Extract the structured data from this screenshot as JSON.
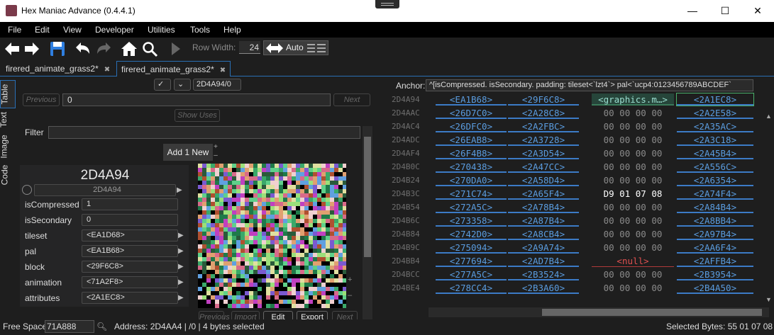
{
  "window": {
    "title": "Hex Maniac Advance (0.4.4.1)",
    "minimize": "—",
    "maximize": "☐",
    "close": "✕"
  },
  "menu": [
    "File",
    "Edit",
    "View",
    "Developer",
    "Utilities",
    "Tools",
    "Help"
  ],
  "toolbar": {
    "row_width_label": "Row Width:",
    "row_width_value": "24",
    "auto_label": "Auto",
    "icons": [
      "back-icon",
      "forward-icon",
      "save-icon",
      "undo-icon",
      "redo-icon",
      "home-icon",
      "search-icon",
      "run-icon"
    ]
  },
  "tabs": [
    {
      "label": "firered_animate_grass2*",
      "close": "✖"
    },
    {
      "label": "firered_animate_grass2*",
      "close": "✖"
    }
  ],
  "left": {
    "side_tabs": [
      "Table",
      "Text",
      "Image",
      "Code"
    ],
    "address_chip": "2D4A94/0",
    "previous": "Previous",
    "next": "Next",
    "index_value": "0",
    "show_uses": "Show Uses",
    "filter_label": "Filter",
    "add_new": "Add 1 New",
    "big_address": "2D4A94",
    "sub_address": "2D4A94",
    "fields": [
      {
        "label": "isCompressed",
        "value": "1"
      },
      {
        "label": "isSecondary",
        "value": "0"
      },
      {
        "label": "tileset",
        "value": "<EA1D68>"
      },
      {
        "label": "pal",
        "value": "<EA1B68>"
      },
      {
        "label": "block",
        "value": "<29F6C8>"
      },
      {
        "label": "animation",
        "value": "<71A2F8>"
      },
      {
        "label": "attributes",
        "value": "<2A1EC8>"
      }
    ],
    "image_buttons": [
      "Previous",
      "Import",
      "Edit",
      "Export",
      "Next"
    ]
  },
  "right": {
    "anchor_label": "Anchor:",
    "anchor_value": "^[isCompressed. isSecondary. padding: tileset<`lzt4`> pal<`ucp4:0123456789ABCDEF`",
    "rows": [
      {
        "addr": "2D4A94",
        "c0": "<EA1B68>",
        "c1": "<29F6C8>",
        "c2": "<graphics.m…>",
        "c3": "<2A1EC8>"
      },
      {
        "addr": "2D4AAC",
        "c0": "<26D7C0>",
        "c1": "<2A28C8>",
        "c2": "00 00 00 00",
        "c3": "<2A2E58>"
      },
      {
        "addr": "2D4AC4",
        "c0": "<26DFC0>",
        "c1": "<2A2FBC>",
        "c2": "00 00 00 00",
        "c3": "<2A35AC>"
      },
      {
        "addr": "2D4ADC",
        "c0": "<26EAB8>",
        "c1": "<2A3728>",
        "c2": "00 00 00 00",
        "c3": "<2A3C18>"
      },
      {
        "addr": "2D4AF4",
        "c0": "<26F4B8>",
        "c1": "<2A3D54>",
        "c2": "00 00 00 00",
        "c3": "<2A45B4>"
      },
      {
        "addr": "2D4B0C",
        "c0": "<270438>",
        "c1": "<2A47CC>",
        "c2": "00 00 00 00",
        "c3": "<2A556C>"
      },
      {
        "addr": "2D4B24",
        "c0": "<270DA0>",
        "c1": "<2A58D4>",
        "c2": "00 00 00 00",
        "c3": "<2A6354>"
      },
      {
        "addr": "2D4B3C",
        "c0": "<271C74>",
        "c1": "<2A65F4>",
        "c2": "D9 01 07 08",
        "c3": "<2A74F4>"
      },
      {
        "addr": "2D4B54",
        "c0": "<272A5C>",
        "c1": "<2A78B4>",
        "c2": "00 00 00 00",
        "c3": "<2A84B4>"
      },
      {
        "addr": "2D4B6C",
        "c0": "<273358>",
        "c1": "<2A87B4>",
        "c2": "00 00 00 00",
        "c3": "<2A8BB4>"
      },
      {
        "addr": "2D4B84",
        "c0": "<2742D0>",
        "c1": "<2A8CB4>",
        "c2": "00 00 00 00",
        "c3": "<2A97B4>"
      },
      {
        "addr": "2D4B9C",
        "c0": "<275094>",
        "c1": "<2A9A74>",
        "c2": "00 00 00 00",
        "c3": "<2AA6F4>"
      },
      {
        "addr": "2D4BB4",
        "c0": "<277694>",
        "c1": "<2AD7B4>",
        "c2": "<null>",
        "c3": "<2AFFB4>"
      },
      {
        "addr": "2D4BCC",
        "c0": "<277A5C>",
        "c1": "<2B3524>",
        "c2": "00 00 00 00",
        "c3": "<2B3954>"
      },
      {
        "addr": "2D4BE4",
        "c0": "<278CC4>",
        "c1": "<2B3A60>",
        "c2": "00 00 00 00",
        "c3": "<2B4A50>"
      }
    ]
  },
  "status": {
    "free_space_label": "Free Space:",
    "free_space_value": "71A888",
    "address_info": "Address: 2D4AA4 | /0 | 4 bytes selected",
    "selected_bytes": "Selected Bytes: 55 01 07 08"
  }
}
